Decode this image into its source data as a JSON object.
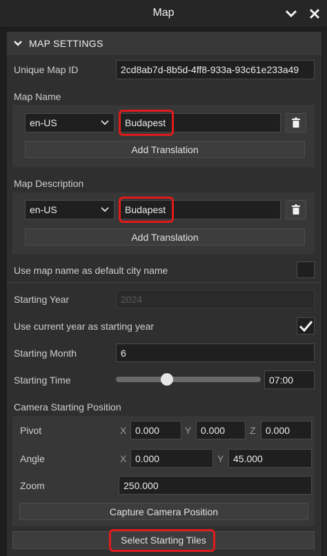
{
  "window": {
    "title": "Map"
  },
  "section": {
    "title": "MAP SETTINGS"
  },
  "unique_id": {
    "label": "Unique Map ID",
    "value": "2cd8ab7d-8b5d-4ff8-933a-93c61e233a49"
  },
  "map_name": {
    "label": "Map Name",
    "locale": "en-US",
    "value": "Budapest",
    "add_translation": "Add Translation"
  },
  "map_description": {
    "label": "Map Description",
    "locale": "en-US",
    "value": "Budapest",
    "add_translation": "Add Translation"
  },
  "use_name_city": {
    "label": "Use map name as default city name",
    "checked": false
  },
  "starting_year": {
    "label": "Starting Year",
    "value": "2024"
  },
  "use_current_year": {
    "label": "Use current year as starting year",
    "checked": true
  },
  "starting_month": {
    "label": "Starting Month",
    "value": "6"
  },
  "starting_time": {
    "label": "Starting Time",
    "value": "07:00",
    "slider_fraction": 0.31
  },
  "camera": {
    "title": "Camera Starting Position",
    "pivot": {
      "label": "Pivot",
      "x": "0.000",
      "y": "0.000",
      "z": "0.000"
    },
    "angle": {
      "label": "Angle",
      "x": "0.000",
      "y": "45.000"
    },
    "zoom": {
      "label": "Zoom",
      "value": "250.000"
    },
    "capture_button": "Capture Camera Position",
    "axis_x": "X",
    "axis_y": "Y",
    "axis_z": "Z"
  },
  "select_tiles_button": "Select Starting Tiles",
  "colors": {
    "highlight": "#e11b1b",
    "panel": "#2f2f2f",
    "input": "#1f1f1f"
  }
}
